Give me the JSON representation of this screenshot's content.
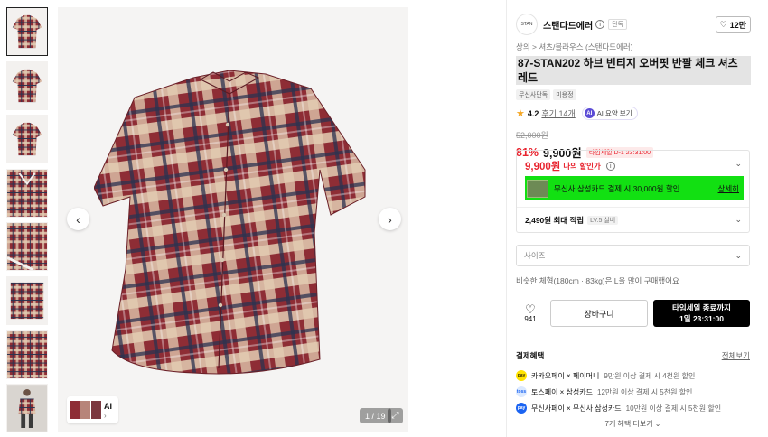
{
  "gallery": {
    "thumb_count": 8,
    "counter": "1 / 19",
    "ai_badge": "AI",
    "prev_arrow": "‹",
    "next_arrow": "›",
    "expand_glyph": "⤢",
    "ai_chevron": "›"
  },
  "brand": {
    "logo_text": "STAN",
    "name": "스탠다드에러",
    "info_glyph": "i",
    "tag": "단독",
    "like_glyph": "♡",
    "like_count": "12만"
  },
  "product": {
    "breadcrumb": "상의 > 셔츠/블라우스 (스탠다드에러)",
    "title": "87-STAN202 하브 빈티지 오버핏 반팔 체크 셔츠 레드",
    "chips": [
      "무신사단독",
      "미용정"
    ],
    "rating_star": "★",
    "rating": "4.2",
    "review_link": "후기 14개",
    "ai_summary_icon": "AI",
    "ai_summary": "AI 요약 보기",
    "original_price": "52,000원",
    "discount": "81%",
    "price": "9,900원",
    "sale_badge": "타임세일 D-1 23:31:00"
  },
  "benefits": {
    "my_price_value": "9,900원",
    "my_price_label": "나의 할인가",
    "info_glyph": "i",
    "chevron": "⌄",
    "card_text": "무신사 삼성카드 결제 시 30,000원 할인",
    "card_detail": "상세히",
    "points_value": "2,490원 최대 적립",
    "points_level": "LV.5 실버"
  },
  "size": {
    "placeholder": "사이즈",
    "chevron": "⌄",
    "note": "비슷한 체형(180cm · 83kg)은 L을 많이 구매했어요"
  },
  "actions": {
    "heart_glyph": "♡",
    "like_count": "941",
    "cart_label": "장바구니",
    "buy_line1": "타임세일 종료까지",
    "buy_line2": "1일 23:31:00"
  },
  "payment": {
    "header": "결제혜택",
    "more_link": "전체보기",
    "items": [
      {
        "icon_text": "pay",
        "brand": "카카오페이 × 페이머니",
        "desc": "9만원 이상 결제 시 4천원 할인"
      },
      {
        "icon_text": "toss",
        "brand": "토스페이 × 삼성카드",
        "desc": "12만원 이상 결제 시 5천원 할인"
      },
      {
        "icon_text": "pay",
        "brand": "무신사페이 × 무신사 삼성카드",
        "desc": "10만원 이상 결제 시 5천원 할인"
      }
    ],
    "expand_label": "7개 혜택 더보기 ⌄"
  },
  "colors": {
    "accent_red": "#e8242f",
    "banner_green": "#12e012",
    "shirt_red": "#8e2d35",
    "shirt_cream": "#e9d4bd",
    "shirt_navy": "#2a3350"
  }
}
